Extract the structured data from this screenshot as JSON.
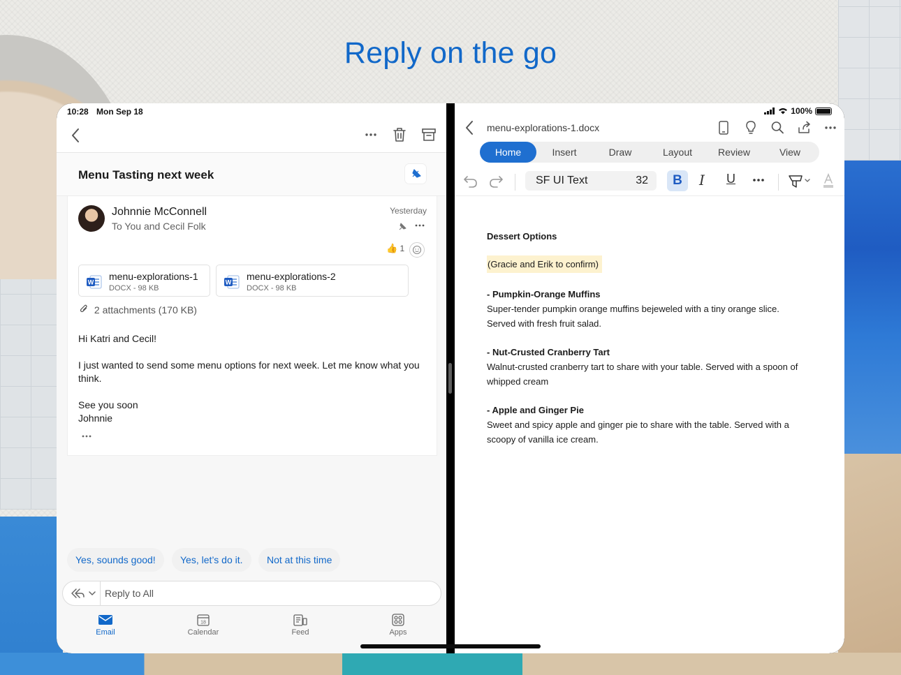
{
  "headline": "Reply on the go",
  "colors": {
    "accent": "#1168c9",
    "word_blue": "#1f6fd0",
    "highlight": "#fdf2cf"
  },
  "outlook": {
    "status": {
      "time": "10:28",
      "date": "Mon Sep 18"
    },
    "toolbar": {
      "back_icon": "chevron-left-icon",
      "more_icon": "more-horizontal-icon",
      "trash_icon": "trash-icon",
      "archive_icon": "archive-icon"
    },
    "subject": "Menu Tasting next week",
    "message": {
      "sender": "Johnnie McConnell",
      "recipients": "To You and Cecil Folk",
      "time": "Yesterday",
      "reaction_emoji": "👍",
      "reaction_count": "1",
      "attachments": [
        {
          "name": "menu-explorations-1",
          "meta": "DOCX - 98 KB"
        },
        {
          "name": "menu-explorations-2",
          "meta": "DOCX - 98 KB"
        }
      ],
      "attachments_summary": "2 attachments (170 KB)",
      "body": {
        "greeting": "Hi Katri and Cecil!",
        "paragraph": "I just wanted to send some menu options for next week. Let me know what you think.",
        "signoff": "See you soon",
        "signature": "Johnnie"
      }
    },
    "quick_replies": [
      "Yes, sounds good!",
      "Yes, let’s do it.",
      "Not at this time"
    ],
    "reply": {
      "placeholder": "Reply to All"
    },
    "tabs": [
      {
        "label": "Email",
        "icon": "mail-icon",
        "active": true
      },
      {
        "label": "Calendar",
        "icon": "calendar-icon",
        "day": "18"
      },
      {
        "label": "Feed",
        "icon": "feed-icon"
      },
      {
        "label": "Apps",
        "icon": "apps-grid-icon"
      }
    ]
  },
  "word": {
    "status": {
      "battery": "100%"
    },
    "doc_title": "menu-explorations-1.docx",
    "ribbon_tabs": [
      "Home",
      "Insert",
      "Draw",
      "Layout",
      "Review",
      "View"
    ],
    "active_tab": "Home",
    "font": {
      "name": "SF UI Text",
      "size": "32"
    },
    "format": {
      "bold": "B",
      "italic": "I",
      "underline": "U"
    },
    "document": {
      "title": "Dessert Options",
      "note": "(Gracie and Erik to confirm)",
      "items": [
        {
          "heading": "- Pumpkin-Orange Muffins",
          "text": "Super-tender pumpkin orange muffins bejeweled with a tiny orange slice. Served with fresh fruit salad."
        },
        {
          "heading": "- Nut-Crusted Cranberry Tart",
          "text": "Walnut-crusted cranberry tart to share with your table. Served with a spoon of whipped cream"
        },
        {
          "heading": "- Apple and Ginger Pie",
          "text": "Sweet and spicy apple and ginger pie to share with the table. Served with a scoopy of vanilla ice cream."
        }
      ]
    }
  }
}
